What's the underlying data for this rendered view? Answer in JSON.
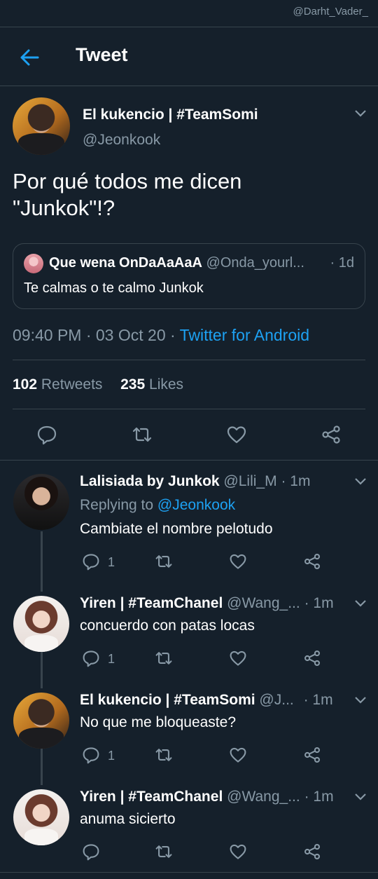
{
  "watermark": "@Darht_Vader_",
  "header": {
    "title": "Tweet"
  },
  "tweet": {
    "author_name": "El kukencio | #TeamSomi",
    "author_handle": "@Jeonkook",
    "text_line1": "Por qué todos me dicen",
    "text_line2": "\"Junkok\"!?",
    "quote": {
      "name": "Que wena OnDaAaAaA",
      "handle": "@Onda_yourl...",
      "time": "· 1d",
      "text": "Te calmas o te calmo Junkok"
    },
    "time": "09:40 PM · 03 Oct 20 ·",
    "client": "Twitter for Android",
    "retweets_count": "102",
    "retweets_label": "Retweets",
    "likes_count": "235",
    "likes_label": "Likes"
  },
  "replies": [
    {
      "name": "Lalisiada by Junkok",
      "handle": "@Lili_M",
      "time": "· 1m",
      "replying_label": "Replying to",
      "replying_handle": "@Jeonkook",
      "text": "Cambiate el nombre pelotudo",
      "reply_count": "1"
    },
    {
      "name": "Yiren | #TeamChanel",
      "handle": "@Wang_...",
      "time": "· 1m",
      "text": "concuerdo con patas locas",
      "reply_count": "1"
    },
    {
      "name": "El kukencio | #TeamSomi",
      "handle": "@J...",
      "time": "· 1m",
      "text": "No que me bloqueaste?",
      "reply_count": "1"
    },
    {
      "name": "Yiren | #TeamChanel",
      "handle": "@Wang_...",
      "time": "· 1m",
      "text": "anuma sicierto"
    }
  ],
  "icons": [
    "back-arrow-icon",
    "chevron-down-icon",
    "reply-icon",
    "retweet-icon",
    "like-icon",
    "share-icon"
  ],
  "colors": {
    "background": "#15202b",
    "accent": "#1da1f2",
    "muted": "#8899a6",
    "border": "#38444d"
  }
}
